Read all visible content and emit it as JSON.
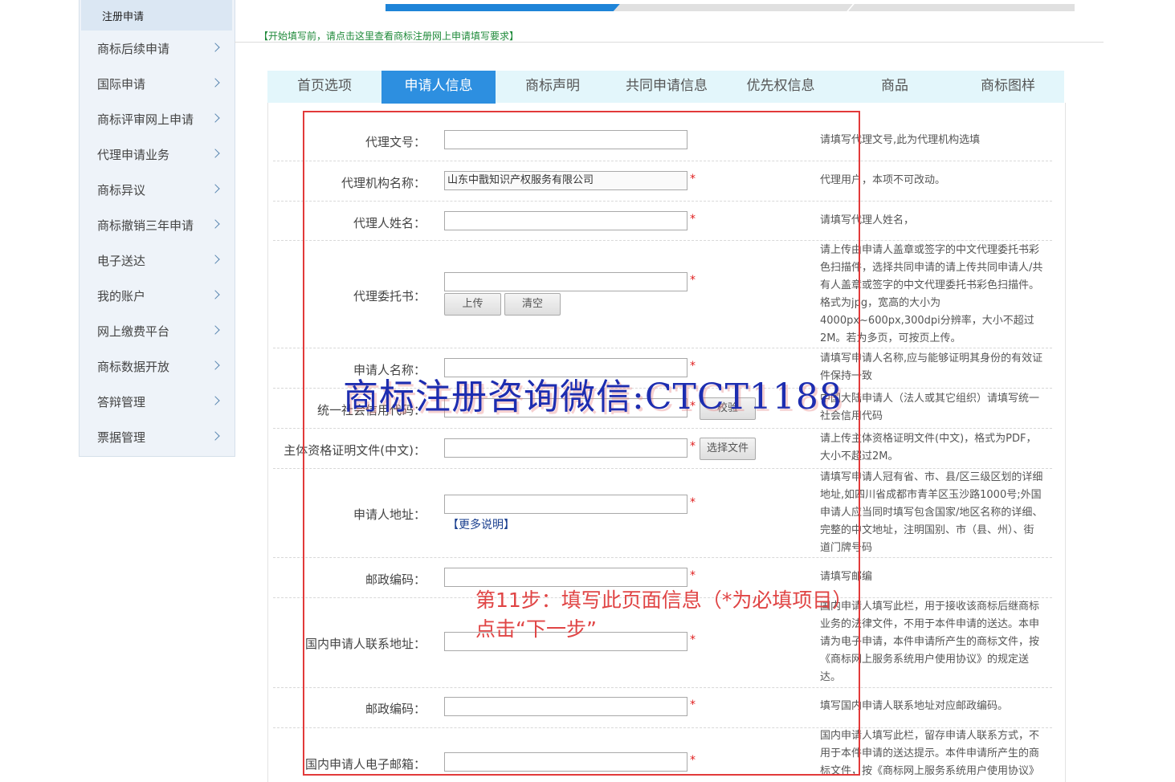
{
  "sidebar": {
    "top_item": "注册申请",
    "items": [
      {
        "label": "商标后续申请"
      },
      {
        "label": "国际申请"
      },
      {
        "label": "商标评审网上申请"
      },
      {
        "label": "代理申请业务"
      },
      {
        "label": "商标异议"
      },
      {
        "label": "商标撤销三年申请"
      },
      {
        "label": "电子送达"
      },
      {
        "label": "我的账户"
      },
      {
        "label": "网上缴费平台"
      },
      {
        "label": "商标数据开放"
      },
      {
        "label": "答辩管理"
      },
      {
        "label": "票据管理"
      }
    ]
  },
  "notice": "【开始填写前，请点击这里查看商标注册网上申请填写要求】",
  "tabs": [
    {
      "label": "首页选项"
    },
    {
      "label": "申请人信息",
      "active": true
    },
    {
      "label": "商标声明"
    },
    {
      "label": "共同申请信息"
    },
    {
      "label": "优先权信息"
    },
    {
      "label": "商品"
    },
    {
      "label": "商标图样"
    }
  ],
  "form": {
    "agent_doc_no": {
      "label": "代理文号：",
      "value": "",
      "hint": "请填写代理文号,此为代理机构选填"
    },
    "agency_name": {
      "label": "代理机构名称：",
      "value": "山东中戬知识产权服务有限公司",
      "required": "*",
      "hint": "代理用户，本项不可改动。"
    },
    "agent_name": {
      "label": "代理人姓名：",
      "value": "",
      "required": "*",
      "hint": "请填写代理人姓名，"
    },
    "power_of_attorney": {
      "label": "代理委托书：",
      "value": "",
      "required": "*",
      "upload_button": "上传",
      "clear_button": "清空",
      "hint_lines": [
        "请上传由申请人盖章或签字的中文代理委托书彩",
        "色扫描件，选择共同申请的请上传共同申请人/共",
        "有人盖章或签字的中文代理委托书彩色扫描件。",
        "格式为jpg，宽高的大小为",
        "4000px~600px,300dpi分辨率，大小不超过",
        "2M。若为多页，可按页上传。"
      ]
    },
    "applicant_name": {
      "label": "申请人名称：",
      "value": "",
      "required": "*",
      "hint_lines": [
        "请填写申请人名称,应与能够证明其身份的有效证",
        "件保持一致"
      ]
    },
    "credit_code": {
      "label": "统一社会信用代码：",
      "value": "",
      "required": "*",
      "verify_button": "校验",
      "hint_lines": [
        "中国大陆申请人（法人或其它组织）请填写统一",
        "社会信用代码"
      ]
    },
    "qualification_doc": {
      "label": "主体资格证明文件(中文)：",
      "value": "",
      "required": "*",
      "choose_button": "选择文件",
      "hint_lines": [
        "请上传主体资格证明文件(中文)，格式为PDF，",
        "大小不超过2M。"
      ]
    },
    "applicant_address": {
      "label": "申请人地址：",
      "value": "",
      "required": "*",
      "more_link": "【更多说明】",
      "hint_lines": [
        "请填写申请人冠有省、市、县/区三级区划的详细",
        "地址,如四川省成都市青羊区玉沙路1000号;外国",
        "申请人应当同时填写包含国家/地区名称的详细、",
        "完整的中文地址，注明国别、市（县、州）、街",
        "道门牌号码"
      ]
    },
    "postal_code": {
      "label": "邮政编码：",
      "value": "",
      "required": "*",
      "hint": "请填写邮编"
    },
    "domestic_contact_address": {
      "label": "国内申请人联系地址：",
      "value": "",
      "required": "*",
      "hint_lines": [
        "国内申请人填写此栏，用于接收该商标后继商标",
        "业务的法律文件，不用于本件申请的送达。本申",
        "请为电子申请，本件申请所产生的商标文件，按",
        "《商标网上服务系统用户使用协议》的规定送",
        "达。"
      ]
    },
    "contact_postal_code": {
      "label": "邮政编码：",
      "value": "",
      "required": "*",
      "hint": "填写国内申请人联系地址对应邮政编码。"
    },
    "domestic_email": {
      "label": "国内申请人电子邮箱：",
      "value": "",
      "required": "*",
      "hint_lines": [
        "国内申请人填写此栏，留存申请人联系方式，不",
        "用于本件申请的送达提示。本件申请所产生的商",
        "标文件，按《商标网上服务系统用户使用协议》"
      ]
    }
  },
  "overlay": {
    "watermark": "商标注册咨询微信:CTCT1188",
    "step_line1": "第11步：填写此页面信息（*为必填项目）",
    "step_line2": "点击“下一步”"
  },
  "progress": {
    "current_fraction": 0.34
  },
  "colors": {
    "accent": "#2d8fe0",
    "tab_bg": "#e3f6fb",
    "required": "#e02020",
    "annotation": "#e23a3a",
    "watermark": "#1d2db0"
  }
}
